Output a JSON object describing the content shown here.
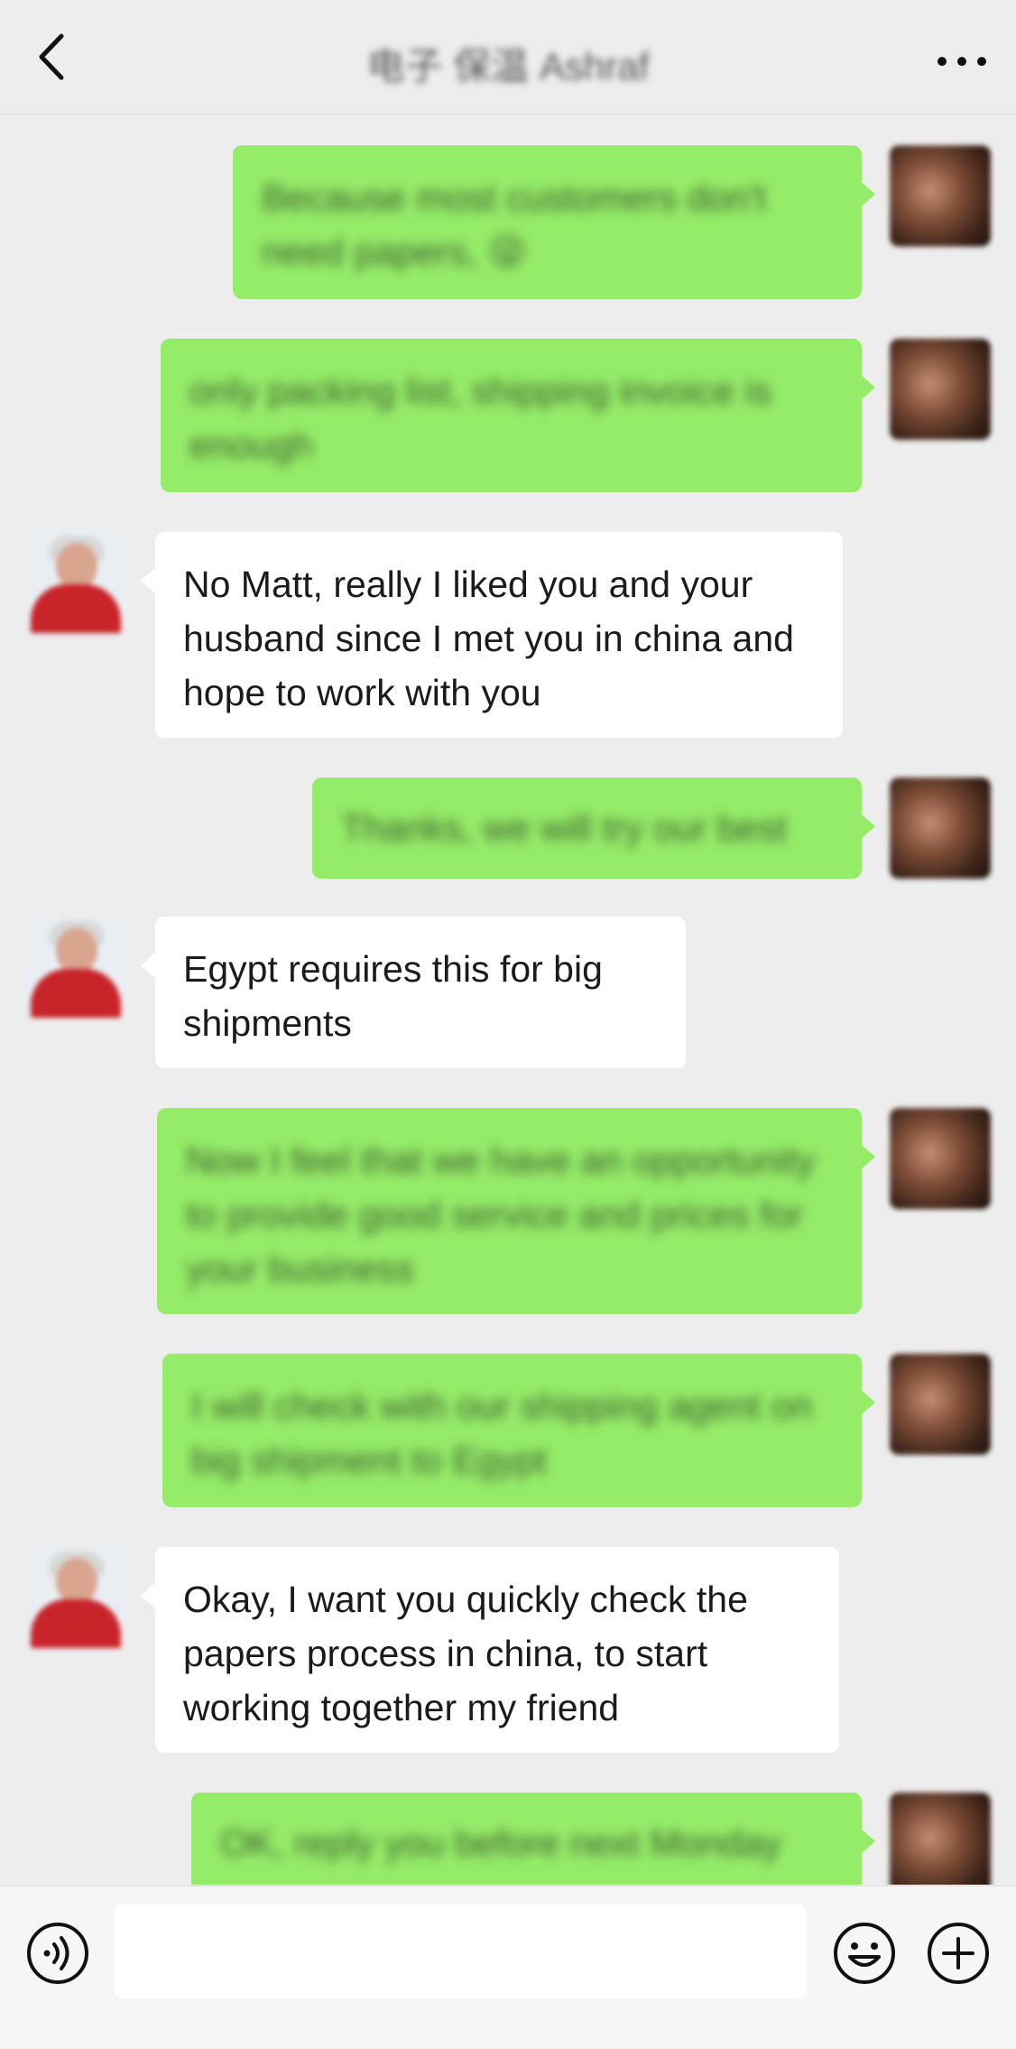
{
  "header": {
    "title": "电子 保温 Ashraf",
    "back_icon": "chevron-left-icon",
    "more_icon": "ellipsis-icon"
  },
  "messages": [
    {
      "side": "mine",
      "text": "Because most customers don't need  papers, 😜"
    },
    {
      "side": "mine",
      "text": "only packing list, shipping invoice is enough"
    },
    {
      "side": "theirs",
      "text": "No Matt, really I liked you and your husband since I met you in china and hope to work with you"
    },
    {
      "side": "mine",
      "text": "Thanks, we will try our best"
    },
    {
      "side": "theirs",
      "text": "Egypt requires this for big shipments"
    },
    {
      "side": "mine",
      "text": "Now I feel that we have an opportunity to provide good service  and prices for your business"
    },
    {
      "side": "mine",
      "text": "I will check with our shipping agent on big shipment to Egypt"
    },
    {
      "side": "theirs",
      "text": "Okay, I want you quickly check the papers process in china, to start working together my friend"
    },
    {
      "side": "mine",
      "text": "OK, reply you before next Monday"
    }
  ],
  "composer": {
    "voice_icon": "voice-icon",
    "emoji_icon": "emoji-icon",
    "plus_icon": "plus-icon",
    "input_value": ""
  },
  "colors": {
    "background": "#ededed",
    "sent_bubble": "#95ec69",
    "received_bubble": "#ffffff"
  }
}
